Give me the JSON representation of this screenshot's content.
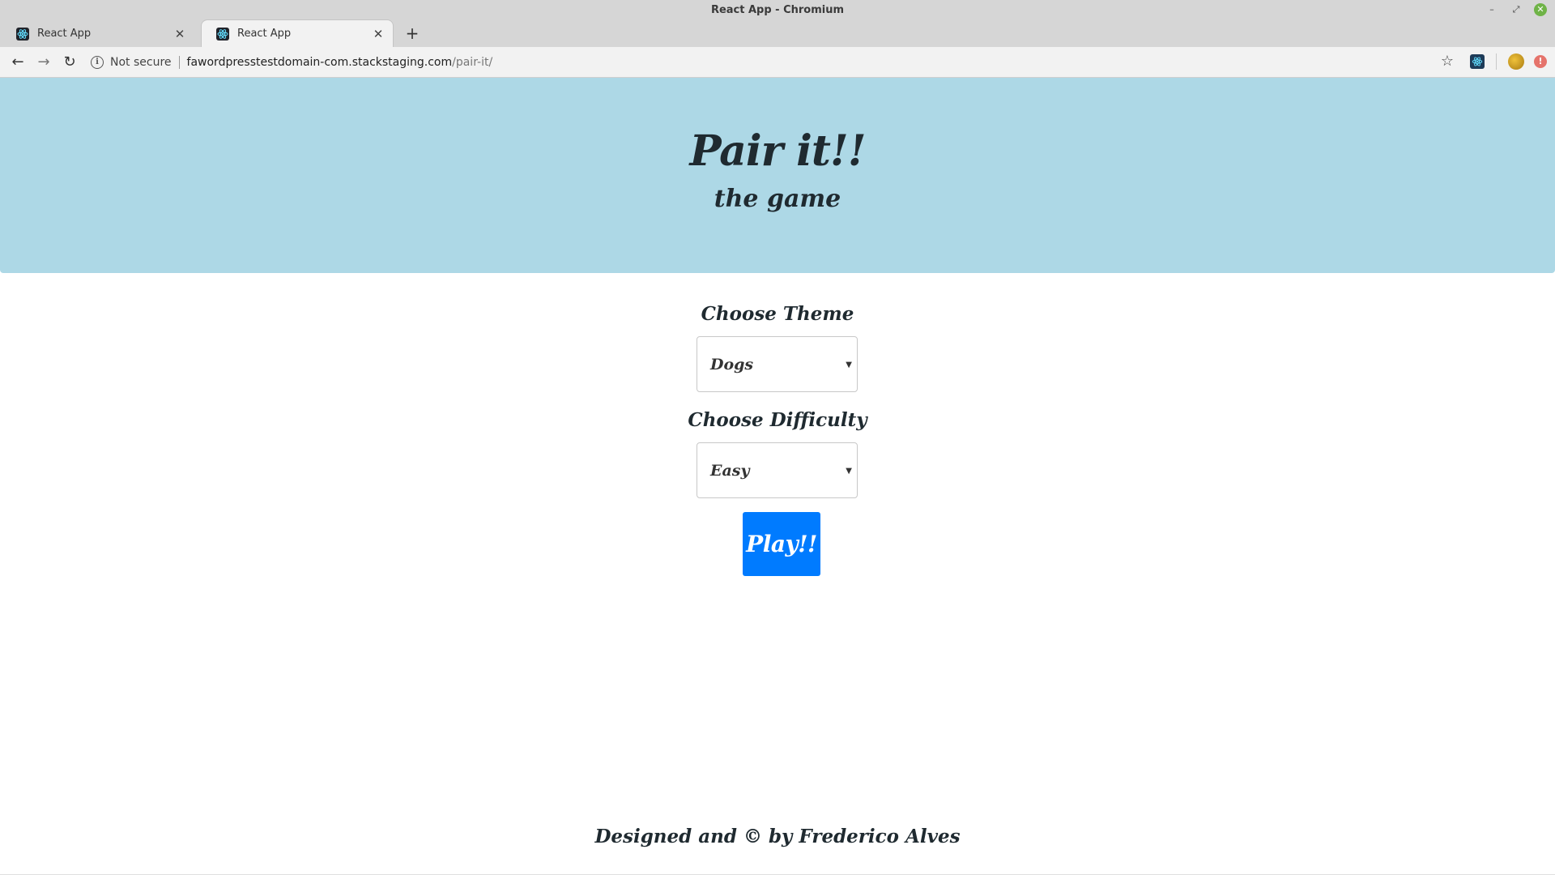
{
  "window": {
    "title": "React App - Chromium"
  },
  "tabs": [
    {
      "title": "React App",
      "active": false,
      "favicon": "react-icon"
    },
    {
      "title": "React App",
      "active": true,
      "favicon": "react-icon"
    }
  ],
  "toolbar": {
    "security_label": "Not secure",
    "url_host": "fawordpresstestdomain-com.stackstaging.com",
    "url_path": "/pair-it/"
  },
  "hero": {
    "title": "Pair it!!",
    "subtitle": "the game",
    "background": "#add8e6"
  },
  "form": {
    "theme_label": "Choose Theme",
    "theme_value": "Dogs",
    "difficulty_label": "Choose Difficulty",
    "difficulty_value": "Easy",
    "play_label": "Play!!",
    "play_color": "#007bff"
  },
  "footer": {
    "text": "Designed and © by Frederico Alves"
  }
}
